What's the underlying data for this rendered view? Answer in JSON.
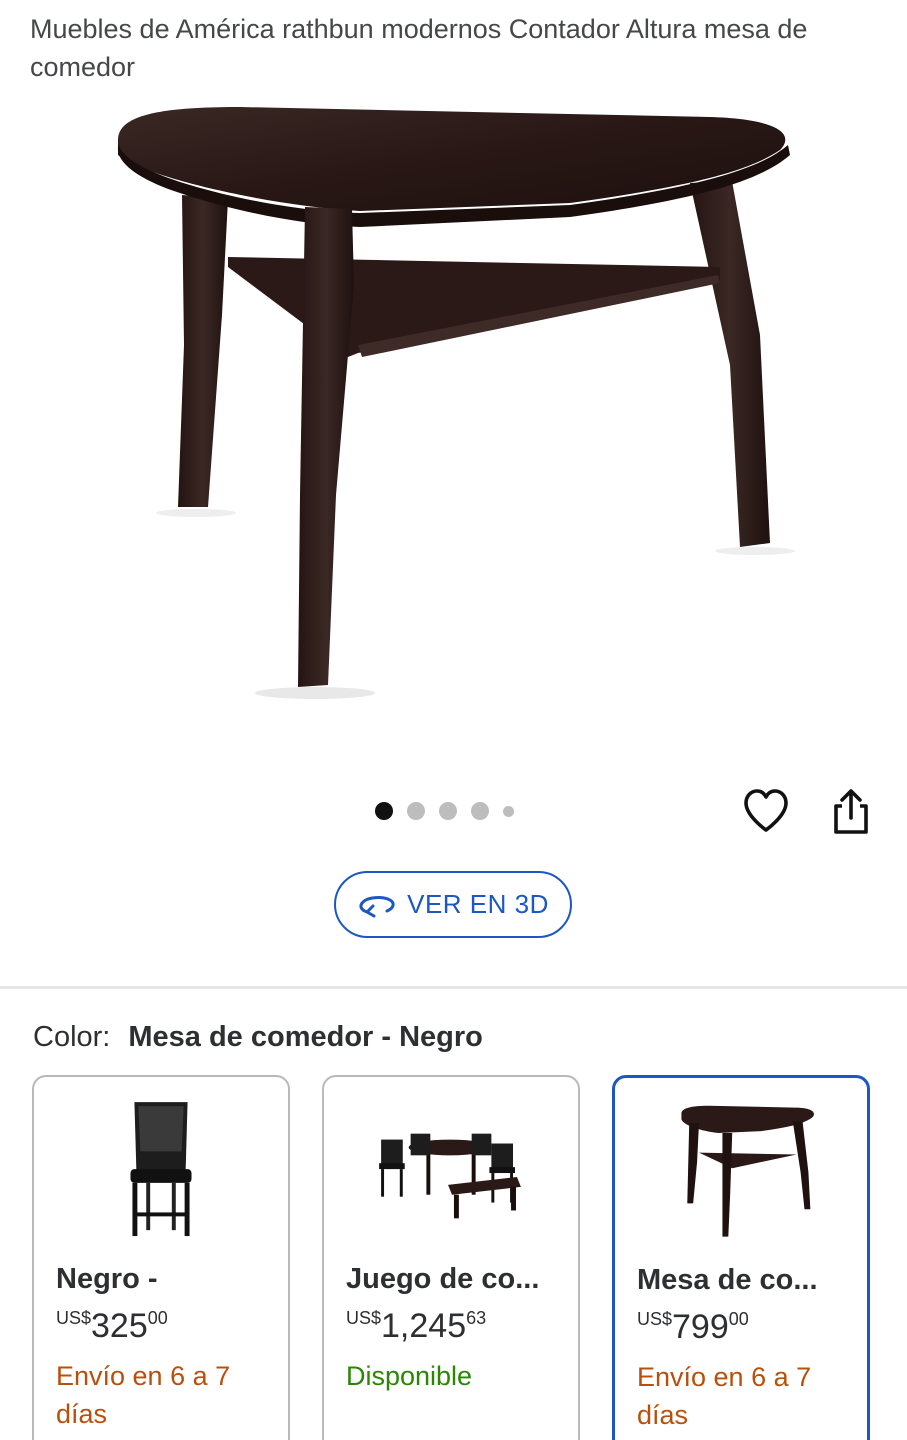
{
  "product": {
    "title": "Muebles de América rathbun modernos Contador Altura mesa de comedor"
  },
  "gallery": {
    "image_count": 5,
    "active_index": 0
  },
  "actions": {
    "favorite_icon": "heart-icon",
    "share_icon": "share-icon",
    "view3d_label": "VER EN 3D",
    "view3d_icon": "rotate-3d-icon"
  },
  "variants": {
    "color_label": "Color:",
    "color_value": "Mesa de comedor - Negro",
    "options": [
      {
        "name": "Negro -",
        "currency": "US$",
        "price_int": "325",
        "price_dec": "00",
        "shipping": "Envío en 6 a 7 días",
        "shipping_status": "shipping",
        "selected": false
      },
      {
        "name": "Juego de co...",
        "currency": "US$",
        "price_int": "1,245",
        "price_dec": "63",
        "shipping": "Disponible",
        "shipping_status": "available",
        "selected": false
      },
      {
        "name": "Mesa de co...",
        "currency": "US$",
        "price_int": "799",
        "price_dec": "00",
        "shipping": "Envío en 6 a 7 días",
        "shipping_status": "shipping",
        "selected": true
      }
    ]
  },
  "colors": {
    "accent": "#1c57c4",
    "shipping": "#b8500c",
    "available": "#2a8703",
    "wood": "#2b1a17"
  }
}
